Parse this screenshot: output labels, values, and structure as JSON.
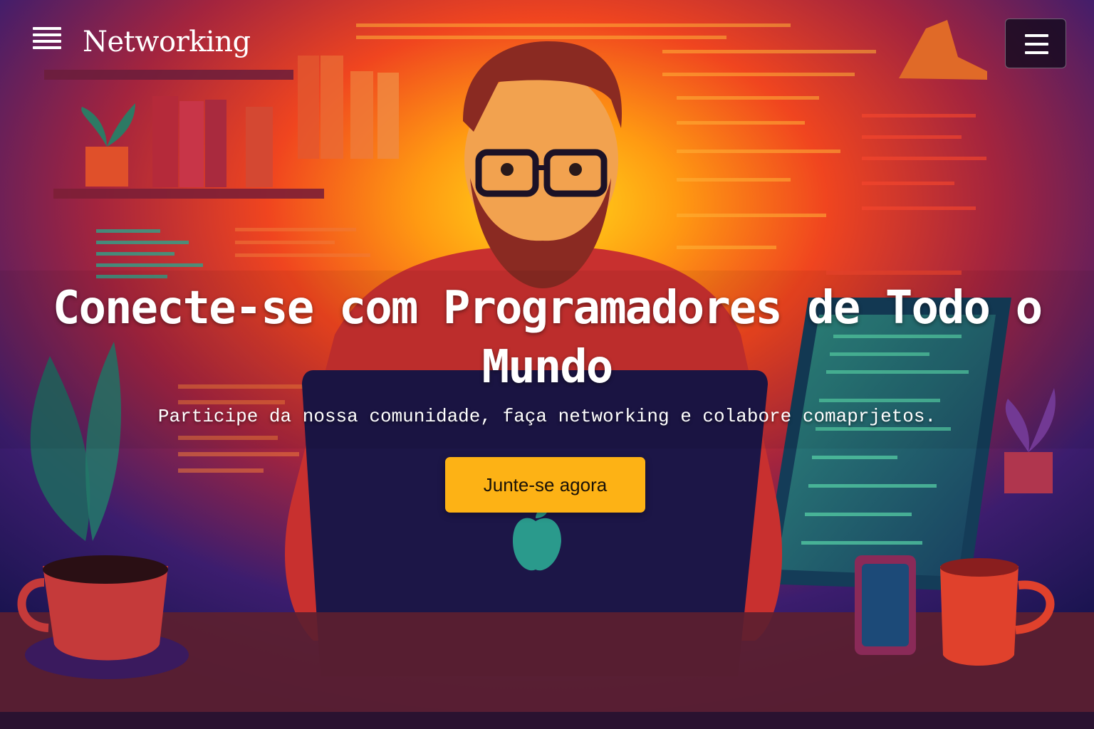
{
  "header": {
    "logo_icon": "list-lines-icon",
    "brand_name": "Networking",
    "menu_icon": "hamburger-menu-icon"
  },
  "hero": {
    "title": "Conecte-se com Programadores de Todo o Mundo",
    "subtitle": "Participe da nossa comunidade, faça networking e colabore comaprjetos.",
    "cta_label": "Junte-se agora"
  },
  "colors": {
    "cta_background": "#fdb215",
    "glow_center": "#ffd21c",
    "background_dark": "#1b1450",
    "text": "#ffffff"
  }
}
